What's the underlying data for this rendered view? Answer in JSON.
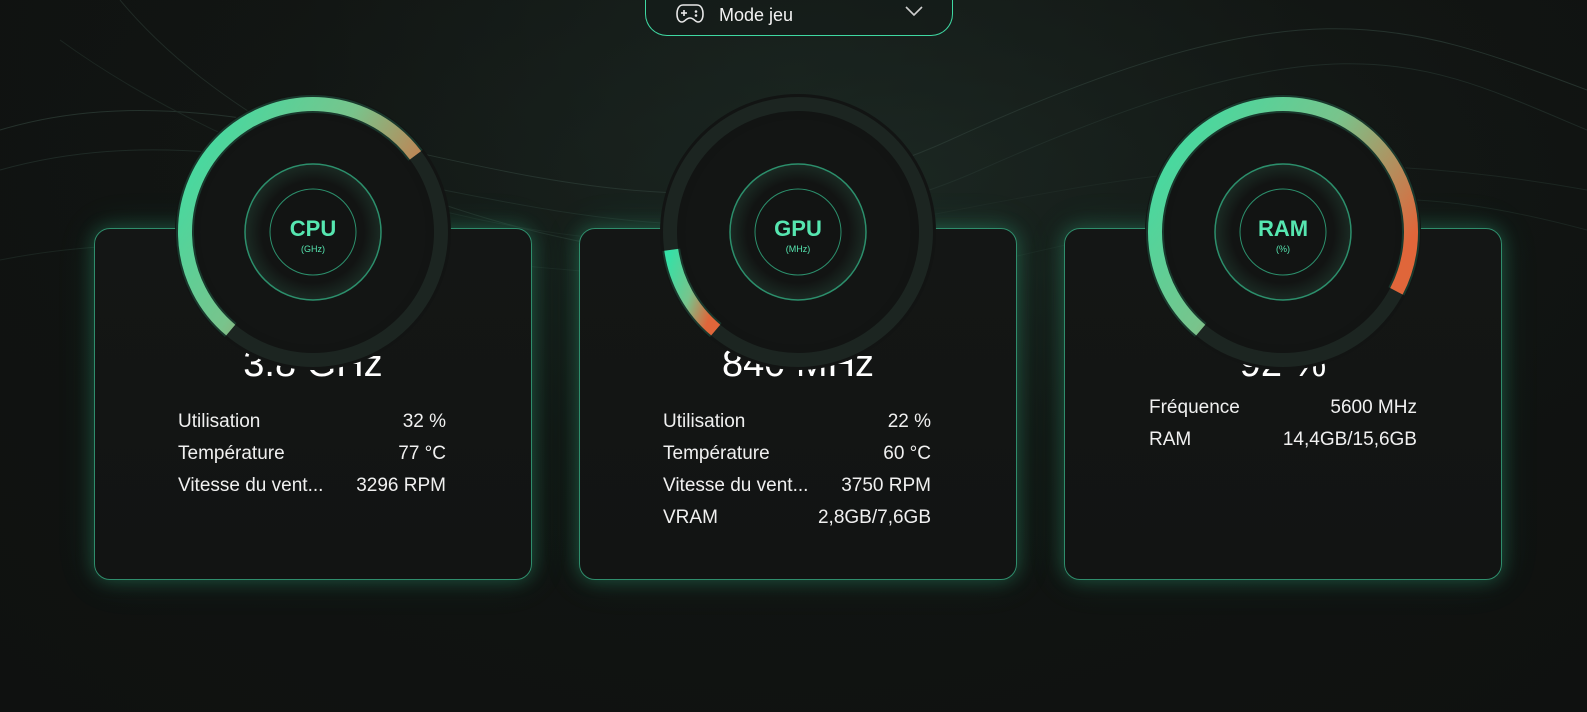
{
  "mode_selector": {
    "label": "Mode jeu",
    "icon": "gamepad-icon"
  },
  "colors": {
    "accent": "#3fd8a2",
    "warm": "#e0663a",
    "background": "#111412"
  },
  "cpu": {
    "name": "CPU",
    "unit": "(GHz)",
    "value": "3.8 GHz",
    "gauge_fraction": 0.69,
    "stats": [
      {
        "label": "Utilisation",
        "value": "32 %"
      },
      {
        "label": "Température",
        "value": "77 °C"
      },
      {
        "label": "Vitesse du vent...",
        "value": "3296 RPM"
      }
    ]
  },
  "gpu": {
    "name": "GPU",
    "unit": "(MHz)",
    "value": "840 MHz",
    "gauge_fraction": 0.15,
    "stats": [
      {
        "label": "Utilisation",
        "value": "22 %"
      },
      {
        "label": "Température",
        "value": "60 °C"
      },
      {
        "label": "Vitesse du vent...",
        "value": "3750 RPM"
      },
      {
        "label": "VRAM",
        "value": "2,8GB/7,6GB"
      }
    ]
  },
  "ram": {
    "name": "RAM",
    "unit": "(%)",
    "value": "92 %",
    "gauge_fraction": 0.92,
    "stats": [
      {
        "label": "Fréquence",
        "value": "5600 MHz"
      },
      {
        "label": "RAM",
        "value": "14,4GB/15,6GB"
      }
    ]
  }
}
